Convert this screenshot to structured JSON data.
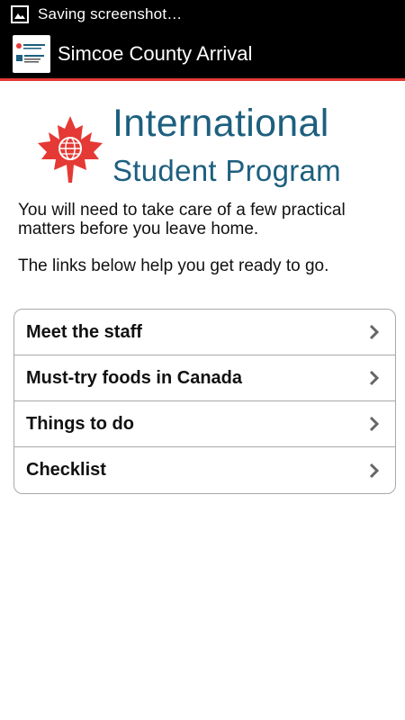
{
  "status_bar": {
    "text": "Saving screenshot…",
    "icon": "image-icon"
  },
  "action_bar": {
    "title": "Simcoe County Arrival",
    "icon": "app-logo-icon",
    "accent_color": "#e53935"
  },
  "logo": {
    "line1": "International",
    "line2": "Student Program",
    "text_color": "#1d5f7f",
    "leaf_color": "#e53935"
  },
  "intro": {
    "paragraph1": "You will need to take care of a few practical matters before you leave home.",
    "paragraph2": "The links below help you get ready to go."
  },
  "menu": {
    "items": [
      {
        "label": "Meet the staff",
        "icon": "chevron-right-icon"
      },
      {
        "label": "Must-try foods in Canada",
        "icon": "chevron-right-icon"
      },
      {
        "label": "Things to do",
        "icon": "chevron-right-icon"
      },
      {
        "label": "Checklist",
        "icon": "chevron-right-icon"
      }
    ]
  }
}
